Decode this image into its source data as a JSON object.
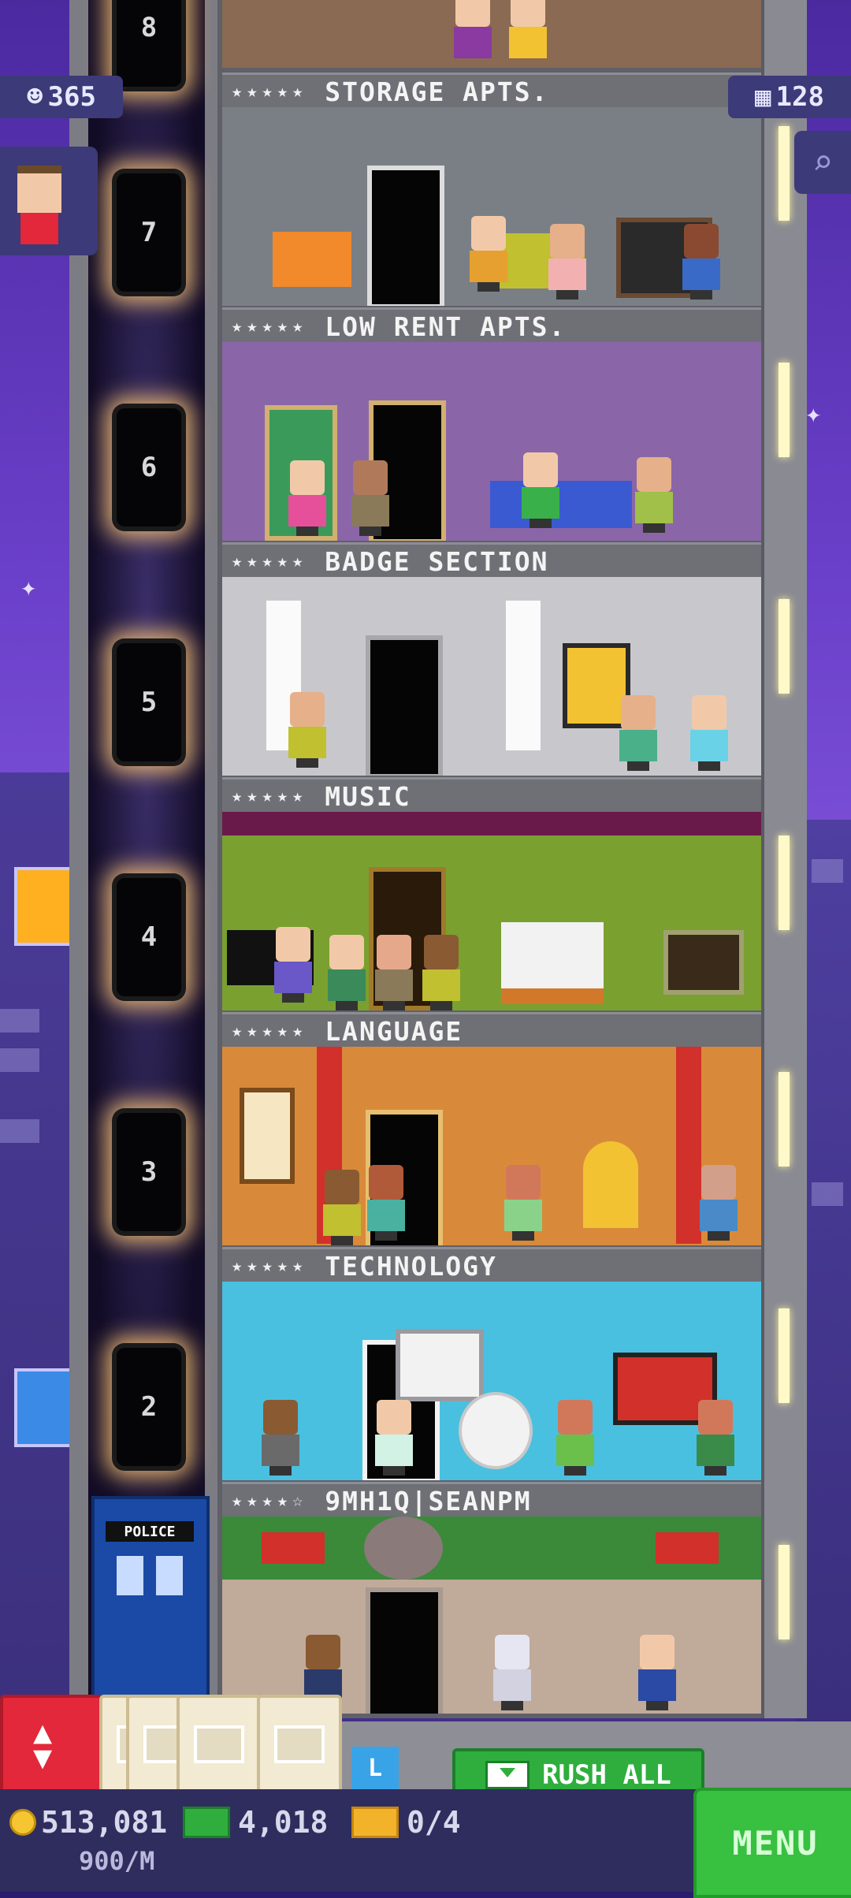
{
  "hud": {
    "population": "365",
    "floor_count": "128",
    "coins": "513,081",
    "coin_rate": "900/M",
    "bux": "4,018",
    "tickets": "0/4",
    "menu_label": "MENU",
    "rush_all_label": "RUSH ALL",
    "partial_button_text": "L"
  },
  "elevator": {
    "floors": [
      "8",
      "7",
      "6",
      "5",
      "4",
      "3",
      "2"
    ]
  },
  "floors": [
    {
      "name": "STORAGE APTS.",
      "stars": "★★★★★"
    },
    {
      "name": "LOW RENT APTS.",
      "stars": "★★★★★"
    },
    {
      "name": "BADGE SECTION",
      "stars": "★★★★★"
    },
    {
      "name": "MUSIC",
      "stars": "★★★★★"
    },
    {
      "name": "LANGUAGE",
      "stars": "★★★★★"
    },
    {
      "name": "TECHNOLOGY",
      "stars": "★★★★★"
    },
    {
      "name": "9MH1Q|SEANPM",
      "stars": "★★★★☆"
    }
  ],
  "signage": {
    "police_box": "POLICE"
  },
  "icons": {
    "population": "person-icon",
    "floors": "building-icon",
    "search": "magnifier-icon",
    "elevator_control": "up-down-arrows-icon",
    "box": "delivery-box-icon",
    "coin": "coin-icon",
    "bux": "tower-bux-icon",
    "ticket": "golden-ticket-icon"
  },
  "colors": {
    "sky": "#6a3fc9",
    "menu_green": "#38c040",
    "rush_green": "#2fae3e",
    "elevator_red": "#e2283a",
    "hud_bar": "#2f2d5e"
  }
}
